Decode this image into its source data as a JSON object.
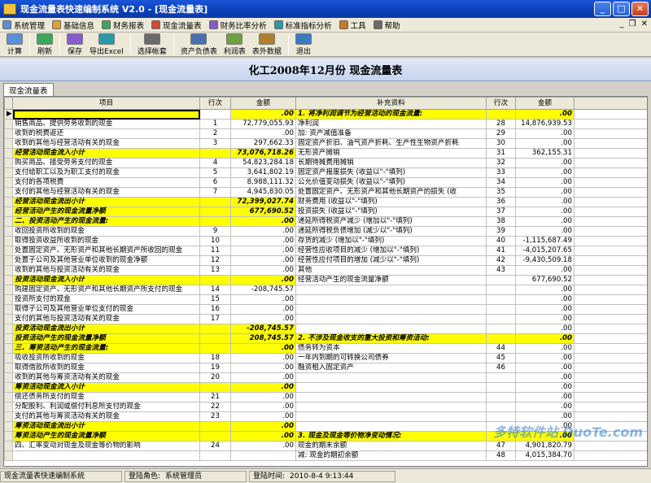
{
  "window": {
    "title": "现金流量表快速编制系统 V2.0 - [现金流量表]"
  },
  "menu": [
    {
      "label": "系统管理",
      "icon": "system-icon"
    },
    {
      "label": "基础信息",
      "icon": "info-icon"
    },
    {
      "label": "财务报表",
      "icon": "report-icon"
    },
    {
      "label": "现金流量表",
      "icon": "cashflow-icon"
    },
    {
      "label": "财务比率分析",
      "icon": "ratio-icon"
    },
    {
      "label": "标准指标分析",
      "icon": "indicator-icon"
    },
    {
      "label": "工具",
      "icon": "tools-icon"
    },
    {
      "label": "帮助",
      "icon": "help-icon"
    }
  ],
  "mdi_controls": {
    "minimize": "_",
    "restore": "❐",
    "close": "✕"
  },
  "toolbar": [
    {
      "label": "计算",
      "icon": "calculate-icon"
    },
    {
      "sep": true
    },
    {
      "label": "刷新",
      "icon": "refresh-icon"
    },
    {
      "sep": true
    },
    {
      "label": "保存",
      "icon": "save-icon"
    },
    {
      "label": "导出Excel",
      "icon": "excel-icon"
    },
    {
      "sep": true
    },
    {
      "label": "选择帐套",
      "icon": "account-set-icon"
    },
    {
      "sep": true
    },
    {
      "label": "资产负债表",
      "icon": "balance-sheet-icon"
    },
    {
      "label": "利润表",
      "icon": "income-statement-icon"
    },
    {
      "label": "表外数据",
      "icon": "off-sheet-icon"
    },
    {
      "sep": true
    },
    {
      "label": "退出",
      "icon": "exit-icon"
    }
  ],
  "report": {
    "title": "化工2008年12月份  现金流量表"
  },
  "tab": {
    "label": "现金流量表"
  },
  "table": {
    "headers": {
      "item": "项目",
      "line": "行次",
      "amount": "金额",
      "supp_item": "补充资料",
      "supp_line": "行次",
      "supp_amount": "金额"
    },
    "rows": [
      {
        "l": "",
        "ln": "",
        "la": ".00",
        "lstyle": "sel",
        "r": "1. 将净利润调节为经营活动的现金流量:",
        "rn": "",
        "ra": ".00",
        "rstyle": "hl"
      },
      {
        "l": "销售商品、提供劳务收到的现金",
        "ln": "1",
        "la": "72,779,055.93",
        "lstyle": "",
        "r": "净利润",
        "rn": "28",
        "ra": "14,876,939.53",
        "rstyle": ""
      },
      {
        "l": "收到的税费返还",
        "ln": "2",
        "la": ".00",
        "lstyle": "",
        "r": "加: 资产减值准备",
        "rn": "29",
        "ra": ".00",
        "rstyle": ""
      },
      {
        "l": "收到的其他与经营活动有关的现金",
        "ln": "3",
        "la": "297,662.33",
        "lstyle": "",
        "r": "   固定资产折旧、油气资产折耗、生产性生物资产折耗",
        "rn": "30",
        "ra": ".00",
        "rstyle": ""
      },
      {
        "l": "      经营活动现金流入小计",
        "ln": "",
        "la": "73,076,718.26",
        "lstyle": "hl",
        "r": "   无形资产摊销",
        "rn": "31",
        "ra": "362,155.31",
        "rstyle": ""
      },
      {
        "l": "购买商品、接受劳务支付的现金",
        "ln": "4",
        "la": "54,823,284.18",
        "lstyle": "",
        "r": "   长期待摊费用摊销",
        "rn": "32",
        "ra": ".00",
        "rstyle": ""
      },
      {
        "l": "支付给职工以及为职工支付的现金",
        "ln": "5",
        "la": "3,641,802.19",
        "lstyle": "",
        "r": "   固定资产报废损失 (收益以\"-\"填列)",
        "rn": "33",
        "ra": ".00",
        "rstyle": ""
      },
      {
        "l": "支付的各项税费",
        "ln": "6",
        "la": "8,988,111.32",
        "lstyle": "",
        "r": "   公允价值变动损失 (收益以\"-\"填列)",
        "rn": "34",
        "ra": ".00",
        "rstyle": ""
      },
      {
        "l": "支付的其他与经营活动有关的现金",
        "ln": "7",
        "la": "4,945,830.05",
        "lstyle": "",
        "r": "   处置固定资产、无形资产和其他长期资产的损失 (收",
        "rn": "35",
        "ra": ".00",
        "rstyle": ""
      },
      {
        "l": "      经营活动现金流出小计",
        "ln": "",
        "la": "72,399,027.74",
        "lstyle": "hl",
        "r": "   财务费用 (收益以\"-\"填列)",
        "rn": "36",
        "ra": ".00",
        "rstyle": ""
      },
      {
        "l": "   经营活动产生的现金流量净额",
        "ln": "",
        "la": "677,690.52",
        "lstyle": "hl",
        "r": "   投资损失 (收益以\"-\"填列)",
        "rn": "37",
        "ra": ".00",
        "rstyle": ""
      },
      {
        "l": "二、投资活动产生的现金流量:",
        "ln": "",
        "la": ".00",
        "lstyle": "hl",
        "r": "   递延所得税资产减少 (增加以\"-\"填列)",
        "rn": "38",
        "ra": ".00",
        "rstyle": ""
      },
      {
        "l": "收回投资所收到的现金",
        "ln": "9",
        "la": ".00",
        "lstyle": "",
        "r": "   递延所得税负债增加 (减少以\"-\"填列)",
        "rn": "39",
        "ra": ".00",
        "rstyle": ""
      },
      {
        "l": "取得投资收益所收到的现金",
        "ln": "10",
        "la": ".00",
        "lstyle": "",
        "r": "   存货的减少 (增加以\"-\"填列)",
        "rn": "40",
        "ra": "-1,115,687.49",
        "rstyle": ""
      },
      {
        "l": "处置固定资产、无形资产和其他长期资产所收回的现金",
        "ln": "11",
        "la": ".00",
        "lstyle": "",
        "r": "   经营性应收项目的减少 (增加以\"-\"填列)",
        "rn": "41",
        "ra": "-4,015,207.65",
        "rstyle": ""
      },
      {
        "l": "处置子公司及其他营业单位收到的现金净额",
        "ln": "12",
        "la": ".00",
        "lstyle": "",
        "r": "   经营性应付项目的增加 (减少以\"-\"填列)",
        "rn": "42",
        "ra": "-9,430,509.18",
        "rstyle": ""
      },
      {
        "l": "收到的其他与投资活动有关的现金",
        "ln": "13",
        "la": ".00",
        "lstyle": "",
        "r": "   其他",
        "rn": "43",
        "ra": ".00",
        "rstyle": ""
      },
      {
        "l": "      投资活动现金流入小计",
        "ln": "",
        "la": ".00",
        "lstyle": "hl",
        "r": "经营活动产生的现金流量净额",
        "rn": "",
        "ra": "677,690.52",
        "rstyle": ""
      },
      {
        "l": "购建固定资产、无形资产和其他长期资产所支付的现金",
        "ln": "14",
        "la": "-208,745.57",
        "lstyle": "",
        "r": "",
        "rn": "",
        "ra": ".00",
        "rstyle": ""
      },
      {
        "l": "投资所支付的现金",
        "ln": "15",
        "la": ".00",
        "lstyle": "",
        "r": "",
        "rn": "",
        "ra": ".00",
        "rstyle": ""
      },
      {
        "l": "取得子公司及其他营业单位支付的现金",
        "ln": "16",
        "la": ".00",
        "lstyle": "",
        "r": "",
        "rn": "",
        "ra": ".00",
        "rstyle": ""
      },
      {
        "l": "支付的其他与投资活动有关的现金",
        "ln": "17",
        "la": ".00",
        "lstyle": "",
        "r": "",
        "rn": "",
        "ra": ".00",
        "rstyle": ""
      },
      {
        "l": "      投资活动现金流出小计",
        "ln": "",
        "la": "-208,745.57",
        "lstyle": "hl",
        "r": "",
        "rn": "",
        "ra": ".00",
        "rstyle": ""
      },
      {
        "l": "   投资活动产生的现金流量净额",
        "ln": "",
        "la": "208,745.57",
        "lstyle": "hl",
        "r": "2. 不涉及现金收支的重大投资和筹资活动:",
        "rn": "",
        "ra": ".00",
        "rstyle": "hl"
      },
      {
        "l": "三、筹资活动产生的现金流量:",
        "ln": "",
        "la": ".00",
        "lstyle": "hl",
        "r": "债务转为资本",
        "rn": "44",
        "ra": ".00",
        "rstyle": ""
      },
      {
        "l": "吸收投资所收到的现金",
        "ln": "18",
        "la": ".00",
        "lstyle": "",
        "r": "一年内到期的可转换公司债券",
        "rn": "45",
        "ra": ".00",
        "rstyle": ""
      },
      {
        "l": "取得借款所收到的现金",
        "ln": "19",
        "la": ".00",
        "lstyle": "",
        "r": "融资租入固定资产",
        "rn": "46",
        "ra": ".00",
        "rstyle": ""
      },
      {
        "l": "收到的其他与筹资活动有关的现金",
        "ln": "20",
        "la": ".00",
        "lstyle": "",
        "r": "",
        "rn": "",
        "ra": ".00",
        "rstyle": ""
      },
      {
        "l": "      筹资活动现金流入小计",
        "ln": "",
        "la": ".00",
        "lstyle": "hl",
        "r": "",
        "rn": "",
        "ra": ".00",
        "rstyle": ""
      },
      {
        "l": "偿还债务所支付的现金",
        "ln": "21",
        "la": ".00",
        "lstyle": "",
        "r": "",
        "rn": "",
        "ra": ".00",
        "rstyle": ""
      },
      {
        "l": "分配股利、利润或偿付利息所支付的现金",
        "ln": "22",
        "la": ".00",
        "lstyle": "",
        "r": "",
        "rn": "",
        "ra": ".00",
        "rstyle": ""
      },
      {
        "l": "支付的其他与筹资活动有关的现金",
        "ln": "23",
        "la": ".00",
        "lstyle": "",
        "r": "",
        "rn": "",
        "ra": ".00",
        "rstyle": ""
      },
      {
        "l": "      筹资活动现金流出小计",
        "ln": "",
        "la": ".00",
        "lstyle": "hl",
        "r": "",
        "rn": "",
        "ra": ".00",
        "rstyle": ""
      },
      {
        "l": "   筹资活动产生的现金流量净额",
        "ln": "",
        "la": ".00",
        "lstyle": "hl",
        "r": "3. 现金及现金等价物净变动情况:",
        "rn": "",
        "ra": ".00",
        "rstyle": "hl"
      },
      {
        "l": "四、汇率变动对现金及现金等价物的影响",
        "ln": "24",
        "la": ".00",
        "lstyle": "",
        "r": "现金的期末余额",
        "rn": "47",
        "ra": "4,901,820.79",
        "rstyle": ""
      },
      {
        "l": "",
        "ln": "",
        "la": "",
        "lstyle": "",
        "r": "减: 现金的期初余额",
        "rn": "48",
        "ra": "4,015,384.70",
        "rstyle": ""
      }
    ]
  },
  "status": {
    "app": "现金流量表快速编制系统",
    "role_label": "登陆角色:",
    "role": "系统管理员",
    "time_label": "登陆时间:",
    "time": "2010-8-4  9:13:44"
  },
  "watermark": {
    "text": "多特软件站 DuoTe.com"
  },
  "colors": {
    "highlight": "#ffff00",
    "title_bar": "#0a3fb8",
    "header_band": "#c5d4ee"
  }
}
